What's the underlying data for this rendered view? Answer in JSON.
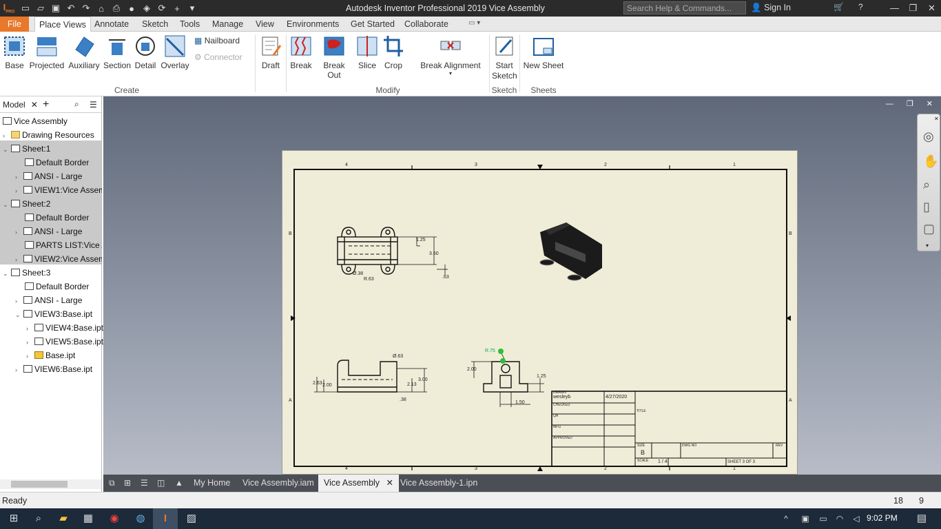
{
  "window": {
    "title": "Autodesk Inventor Professional 2019   Vice Assembly",
    "search_placeholder": "Search Help & Commands...",
    "signin": "Sign In",
    "app_badge": "PRO"
  },
  "tabs": {
    "file": "File",
    "items": [
      "Place Views",
      "Annotate",
      "Sketch",
      "Tools",
      "Manage",
      "View",
      "Environments",
      "Get Started",
      "Collaborate"
    ]
  },
  "ribbon": {
    "buttons": {
      "base": "Base",
      "projected": "Projected",
      "auxiliary": "Auxiliary",
      "section": "Section",
      "detail": "Detail",
      "overlay": "Overlay",
      "nailboard": "Nailboard",
      "connector": "Connector",
      "draft": "Draft",
      "break": "Break",
      "break_out": "Break Out",
      "slice": "Slice",
      "crop": "Crop",
      "break_alignment": "Break Alignment",
      "start_sketch": "Start Sketch",
      "new_sheet": "New Sheet"
    },
    "groups": {
      "create": "Create",
      "modify": "Modify",
      "sketch": "Sketch",
      "sheets": "Sheets"
    }
  },
  "browser": {
    "tab": "Model",
    "nodes": [
      "Vice Assembly",
      "Drawing Resources",
      "Sheet:1",
      "Default Border",
      "ANSI - Large",
      "VIEW1:Vice Assembly",
      "Sheet:2",
      "Default Border",
      "ANSI - Large",
      "PARTS LIST:Vice Assembly",
      "VIEW2:Vice Assembly",
      "Sheet:3",
      "Default Border",
      "ANSI - Large",
      "VIEW3:Base.ipt",
      "VIEW4:Base.ipt",
      "VIEW5:Base.ipt",
      "Base.ipt",
      "VIEW6:Base.ipt"
    ]
  },
  "drawing": {
    "col_labels": [
      "4",
      "3",
      "2",
      "1"
    ],
    "row_labels": [
      "B",
      "A"
    ],
    "dims": {
      "d1": "1.25",
      "d2": "3.50",
      "d3": "Ø.38",
      "d4": "R.63",
      "d5": ".63",
      "d6": "Ø.63",
      "d7": "2.63",
      "d8": "2.00",
      "d9": "3.00",
      "d10": "2.13",
      "d11": ".38",
      "d12": "R.75",
      "d13": "2.00",
      "d14": "1.25",
      "d15": "1.50"
    },
    "title_block": {
      "drawn_label": "DRAWN",
      "drawn_by": "wesleyb",
      "date": "4/27/2020",
      "checked": "CHECKED",
      "title": "TITLE",
      "qa": "QA",
      "mfg": "MFG",
      "approved": "APPROVED",
      "size_label": "SIZE",
      "size": "B",
      "dwg_no": "DWG NO",
      "rev": "REV",
      "scale_label": "SCALE",
      "scale": "1 / 4",
      "sheet": "SHEET 3  OF 3"
    }
  },
  "doc_tabs": [
    "My Home",
    "Vice Assembly.iam",
    "Vice Assembly",
    "Vice Assembly-1.ipn"
  ],
  "status": {
    "text": "Ready",
    "n1": "18",
    "n2": "9"
  },
  "taskbar": {
    "time": "9:02 PM"
  },
  "colors": {
    "file_tab": "#e8782a",
    "sheet": "#efedd8",
    "titlebar": "#2b2b2b"
  }
}
